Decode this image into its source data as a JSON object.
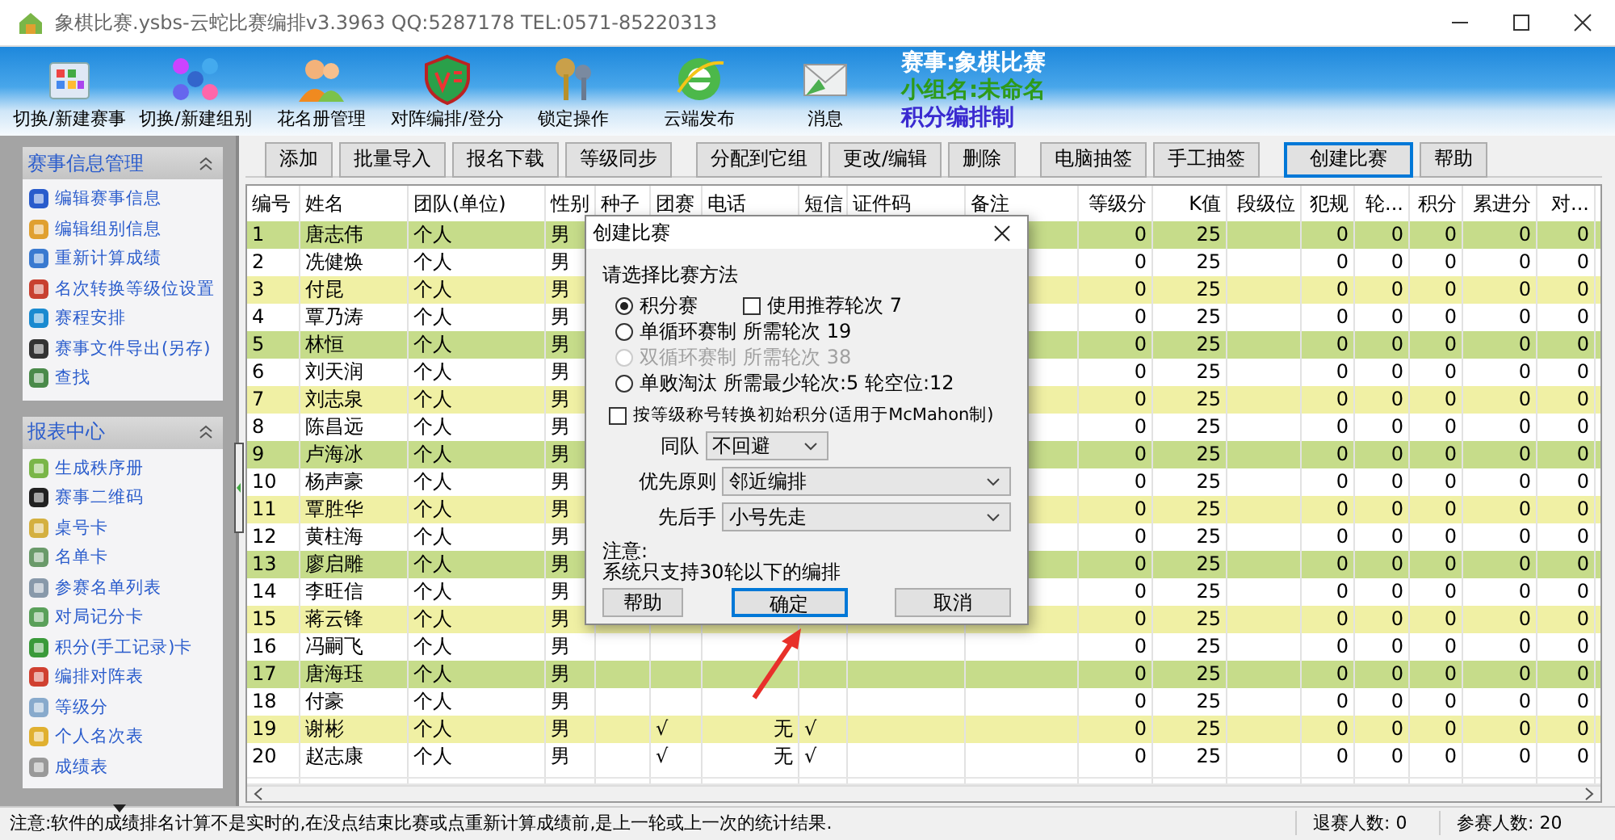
{
  "window": {
    "title": "象棋比赛.ysbs-云蛇比赛编排v3.3963 QQ:5287178 TEL:0571-85220313"
  },
  "toolbar": {
    "items": [
      {
        "label": "切换/新建赛事"
      },
      {
        "label": "切换/新建组别"
      },
      {
        "label": "花名册管理"
      },
      {
        "label": "对阵编排/登分"
      },
      {
        "label": "锁定操作"
      },
      {
        "label": "云端发布"
      },
      {
        "label": "消息"
      }
    ],
    "info": {
      "event": "赛事:象棋比赛",
      "group": "小组名:未命名",
      "system": "积分编排制"
    }
  },
  "sidebar": {
    "sections": [
      {
        "title": "赛事信息管理",
        "items": [
          "编辑赛事信息",
          "编辑组别信息",
          "重新计算成绩",
          "名次转换等级位设置",
          "赛程安排",
          "赛事文件导出(另存)",
          "查找"
        ]
      },
      {
        "title": "报表中心",
        "items": [
          "生成秩序册",
          "赛事二维码",
          "桌号卡",
          "名单卡",
          "参赛名单列表",
          "对局记分卡",
          "积分(手工记录)卡",
          "编排对阵表",
          "等级分",
          "个人名次表",
          "成绩表"
        ]
      }
    ]
  },
  "actions": [
    {
      "label": "添加",
      "selected": false
    },
    {
      "label": "批量导入",
      "selected": false
    },
    {
      "label": "报名下载",
      "selected": false
    },
    {
      "label": "等级同步",
      "selected": false
    },
    {
      "label": "分配到它组",
      "selected": false
    },
    {
      "label": "更改/编辑",
      "selected": false
    },
    {
      "label": "删除",
      "selected": false
    },
    {
      "label": "电脑抽签",
      "selected": false
    },
    {
      "label": "手工抽签",
      "selected": false
    },
    {
      "label": "创建比赛",
      "selected": true
    },
    {
      "label": "帮助",
      "selected": false
    }
  ],
  "table": {
    "columns": [
      "编号",
      "姓名",
      "团队(单位)",
      "性别",
      "种子",
      "团赛",
      "电话",
      "短信",
      "证件码",
      "备注",
      "等级分",
      "K值",
      "段级位",
      "犯规",
      "轮...",
      "积分",
      "累进分",
      "对..."
    ],
    "rows": [
      {
        "no": "1",
        "name": "唐志伟",
        "team": "个人",
        "gender": "男",
        "rating": "0",
        "k": "25",
        "foul": "0",
        "col_15": "0",
        "score": "0",
        "cumulative": "0",
        "col_18": "0",
        "color": "#c6dc8a"
      },
      {
        "no": "2",
        "name": "冼健焕",
        "team": "个人",
        "gender": "男",
        "rating": "0",
        "k": "25",
        "foul": "0",
        "col_15": "0",
        "score": "0",
        "cumulative": "0",
        "col_18": "0",
        "color": "#ffffff"
      },
      {
        "no": "3",
        "name": "付昆",
        "team": "个人",
        "gender": "男",
        "rating": "0",
        "k": "25",
        "foul": "0",
        "col_15": "0",
        "score": "0",
        "cumulative": "0",
        "col_18": "0",
        "color": "#f0f0a4"
      },
      {
        "no": "4",
        "name": "覃乃涛",
        "team": "个人",
        "gender": "男",
        "rating": "0",
        "k": "25",
        "foul": "0",
        "col_15": "0",
        "score": "0",
        "cumulative": "0",
        "col_18": "0",
        "color": "#ffffff"
      },
      {
        "no": "5",
        "name": "林恒",
        "team": "个人",
        "gender": "男",
        "rating": "0",
        "k": "25",
        "foul": "0",
        "col_15": "0",
        "score": "0",
        "cumulative": "0",
        "col_18": "0",
        "color": "#c6dc8a"
      },
      {
        "no": "6",
        "name": "刘天润",
        "team": "个人",
        "gender": "男",
        "rating": "0",
        "k": "25",
        "foul": "0",
        "col_15": "0",
        "score": "0",
        "cumulative": "0",
        "col_18": "0",
        "color": "#ffffff"
      },
      {
        "no": "7",
        "name": "刘志泉",
        "team": "个人",
        "gender": "男",
        "rating": "0",
        "k": "25",
        "foul": "0",
        "col_15": "0",
        "score": "0",
        "cumulative": "0",
        "col_18": "0",
        "color": "#f0f0a4"
      },
      {
        "no": "8",
        "name": "陈昌远",
        "team": "个人",
        "gender": "男",
        "rating": "0",
        "k": "25",
        "foul": "0",
        "col_15": "0",
        "score": "0",
        "cumulative": "0",
        "col_18": "0",
        "color": "#ffffff"
      },
      {
        "no": "9",
        "name": "卢海冰",
        "team": "个人",
        "gender": "男",
        "rating": "0",
        "k": "25",
        "foul": "0",
        "col_15": "0",
        "score": "0",
        "cumulative": "0",
        "col_18": "0",
        "color": "#c6dc8a"
      },
      {
        "no": "10",
        "name": "杨声豪",
        "team": "个人",
        "gender": "男",
        "rating": "0",
        "k": "25",
        "foul": "0",
        "col_15": "0",
        "score": "0",
        "cumulative": "0",
        "col_18": "0",
        "color": "#ffffff"
      },
      {
        "no": "11",
        "name": "覃胜华",
        "team": "个人",
        "gender": "男",
        "rating": "0",
        "k": "25",
        "foul": "0",
        "col_15": "0",
        "score": "0",
        "cumulative": "0",
        "col_18": "0",
        "color": "#f0f0a4"
      },
      {
        "no": "12",
        "name": "黄柱海",
        "team": "个人",
        "gender": "男",
        "rating": "0",
        "k": "25",
        "foul": "0",
        "col_15": "0",
        "score": "0",
        "cumulative": "0",
        "col_18": "0",
        "color": "#ffffff"
      },
      {
        "no": "13",
        "name": "廖启雕",
        "team": "个人",
        "gender": "男",
        "rating": "0",
        "k": "25",
        "foul": "0",
        "col_15": "0",
        "score": "0",
        "cumulative": "0",
        "col_18": "0",
        "color": "#c6dc8a"
      },
      {
        "no": "14",
        "name": "李旺信",
        "team": "个人",
        "gender": "男",
        "rating": "0",
        "k": "25",
        "foul": "0",
        "col_15": "0",
        "score": "0",
        "cumulative": "0",
        "col_18": "0",
        "color": "#ffffff"
      },
      {
        "no": "15",
        "name": "蒋云锋",
        "team": "个人",
        "gender": "男",
        "rating": "0",
        "k": "25",
        "foul": "0",
        "col_15": "0",
        "score": "0",
        "cumulative": "0",
        "col_18": "0",
        "color": "#f0f0a4"
      },
      {
        "no": "16",
        "name": "冯嗣飞",
        "team": "个人",
        "gender": "男",
        "rating": "0",
        "k": "25",
        "foul": "0",
        "col_15": "0",
        "score": "0",
        "cumulative": "0",
        "col_18": "0",
        "color": "#ffffff"
      },
      {
        "no": "17",
        "name": "唐海珏",
        "team": "个人",
        "gender": "男",
        "rating": "0",
        "k": "25",
        "foul": "0",
        "col_15": "0",
        "score": "0",
        "cumulative": "0",
        "col_18": "0",
        "color": "#c6dc8a"
      },
      {
        "no": "18",
        "name": "付豪",
        "team": "个人",
        "gender": "男",
        "rating": "0",
        "k": "25",
        "foul": "0",
        "col_15": "0",
        "score": "0",
        "cumulative": "0",
        "col_18": "0",
        "color": "#ffffff"
      },
      {
        "no": "19",
        "name": "谢彬",
        "team": "个人",
        "gender": "男",
        "team_event": "√",
        "phone": "无",
        "sms": "√",
        "rating": "0",
        "k": "25",
        "foul": "0",
        "col_15": "0",
        "score": "0",
        "cumulative": "0",
        "col_18": "0",
        "color": "#f0f0a4"
      },
      {
        "no": "20",
        "name": "赵志康",
        "team": "个人",
        "gender": "男",
        "team_event": "√",
        "phone": "无",
        "sms": "√",
        "rating": "0",
        "k": "25",
        "foul": "0",
        "col_15": "0",
        "score": "0",
        "cumulative": "0",
        "col_18": "0",
        "color": "#ffffff"
      }
    ]
  },
  "dialog": {
    "title": "创建比赛",
    "prompt": "请选择比赛方法",
    "methods": [
      {
        "label": "积分赛",
        "selected": true,
        "disabled": false
      },
      {
        "label": "单循环赛制",
        "detail": "所需轮次 19",
        "selected": false,
        "disabled": false
      },
      {
        "label": "双循环赛制",
        "detail": "所需轮次 38",
        "selected": false,
        "disabled": true
      },
      {
        "label": "单败淘汰",
        "detail": "所需最少轮次:5 轮空位:12",
        "selected": false,
        "disabled": false
      }
    ],
    "recommend": {
      "label": "使用推荐轮次 7",
      "checked": false
    },
    "mcmahon": {
      "label": "按等级称号转换初始积分(适用于McMahon制)",
      "checked": false
    },
    "selects": [
      {
        "label": "同队",
        "value": "不回避"
      },
      {
        "label": "优先原则",
        "value": "邻近编排"
      },
      {
        "label": "先后手",
        "value": "小号先走"
      }
    ],
    "note": [
      "注意:",
      "系统只支持30轮以下的编排"
    ],
    "buttons": [
      {
        "label": "帮助",
        "kind": "normal"
      },
      {
        "label": "确定",
        "kind": "default"
      },
      {
        "label": "取消",
        "kind": "normal"
      }
    ]
  },
  "status_bar": {
    "message": "注意:软件的成绩排名计算不是实时的,在没点结束比赛或点重新计算成绩前,是上一轮或上一次的统计结果.",
    "withdrawn": "退赛人数: 0",
    "participants": "参赛人数: 20"
  }
}
